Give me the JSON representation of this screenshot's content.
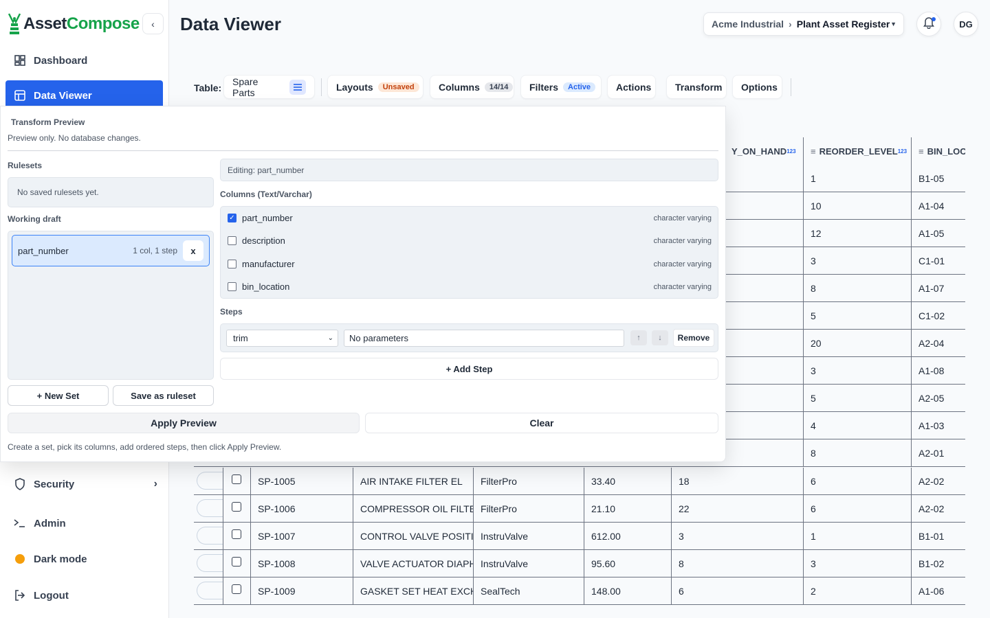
{
  "brand": {
    "name_part1": "Asset",
    "name_part2": "Compose",
    "accent": "#16a34a"
  },
  "sidebar": {
    "items": [
      {
        "label": "Dashboard",
        "icon": "dashboard-icon"
      },
      {
        "label": "Data Viewer",
        "icon": "table-icon",
        "active": true
      },
      {
        "label": "Security",
        "icon": "shield-icon"
      },
      {
        "label": "Admin",
        "icon": "terminal-icon"
      },
      {
        "label": "Dark mode",
        "icon": "theme-dot-icon"
      },
      {
        "label": "Logout",
        "icon": "logout-icon"
      }
    ]
  },
  "header": {
    "title": "Data Viewer",
    "breadcrumb": {
      "org": "Acme Industrial",
      "separator": "›",
      "register": "Plant Asset Register"
    },
    "avatar": "DG"
  },
  "toolbar": {
    "table_label": "Table:",
    "table_value": "Spare Parts",
    "layouts": {
      "label": "Layouts",
      "badge": "Unsaved"
    },
    "columns": {
      "label": "Columns",
      "badge": "14/14"
    },
    "filters": {
      "label": "Filters",
      "badge": "Active"
    },
    "actions": "Actions",
    "transform": "Transform",
    "options": "Options"
  },
  "grid": {
    "headers": [
      "Y_ON_HAND",
      "REORDER_LEVEL",
      "BIN_LOCA"
    ],
    "num_tag": "123",
    "rows_partial": [
      {
        "reorder": "1",
        "bin": "B1-05"
      },
      {
        "reorder": "10",
        "bin": "A1-04"
      },
      {
        "reorder": "12",
        "bin": "A1-05"
      },
      {
        "reorder": "3",
        "bin": "C1-01"
      },
      {
        "reorder": "8",
        "bin": "A1-07"
      },
      {
        "reorder": "5",
        "bin": "C1-02"
      },
      {
        "reorder": "20",
        "bin": "A2-04"
      },
      {
        "reorder": "3",
        "bin": "A1-08"
      },
      {
        "reorder": "5",
        "bin": "A2-05"
      },
      {
        "reorder": "4",
        "bin": "A1-03"
      },
      {
        "reorder": "8",
        "bin": "A2-01"
      }
    ],
    "rows_full": [
      {
        "part": "SP-1005",
        "desc": "AIR INTAKE FILTER EL",
        "mfr": "FilterPro",
        "cost": "33.40",
        "qty": "18",
        "reorder": "6",
        "bin": "A2-02"
      },
      {
        "part": "SP-1006",
        "desc": "COMPRESSOR OIL FILTE",
        "mfr": "FilterPro",
        "cost": "21.10",
        "qty": "22",
        "reorder": "6",
        "bin": "A2-02"
      },
      {
        "part": "SP-1007",
        "desc": "CONTROL VALVE POSITI",
        "mfr": "InstruValve",
        "cost": "612.00",
        "qty": "3",
        "reorder": "1",
        "bin": "B1-01"
      },
      {
        "part": "SP-1008",
        "desc": "VALVE ACTUATOR DIAPH",
        "mfr": "InstruValve",
        "cost": "95.60",
        "qty": "8",
        "reorder": "3",
        "bin": "B1-02"
      },
      {
        "part": "SP-1009",
        "desc": "GASKET SET HEAT EXCH",
        "mfr": "SealTech",
        "cost": "148.00",
        "qty": "6",
        "reorder": "2",
        "bin": "A1-06"
      }
    ]
  },
  "transform": {
    "title": "Transform Preview",
    "subtitle": "Preview only. No database changes.",
    "rulesets_label": "Rulesets",
    "rulesets_empty": "No saved rulesets yet.",
    "draft_label": "Working draft",
    "draft_item": {
      "name": "part_number",
      "meta": "1 col, 1 step",
      "remove": "x"
    },
    "new_set": "+ New Set",
    "save_ruleset": "Save as ruleset",
    "editing": "Editing: part_number",
    "columns_label": "Columns (Text/Varchar)",
    "columns": [
      {
        "name": "part_number",
        "type": "character varying",
        "checked": true
      },
      {
        "name": "description",
        "type": "character varying",
        "checked": false
      },
      {
        "name": "manufacturer",
        "type": "character varying",
        "checked": false
      },
      {
        "name": "bin_location",
        "type": "character varying",
        "checked": false
      }
    ],
    "steps_label": "Steps",
    "step": {
      "op": "trim",
      "params": "No parameters",
      "remove": "Remove"
    },
    "add_step": "+ Add Step",
    "apply": "Apply Preview",
    "clear": "Clear",
    "hint": "Create a set, pick its columns, add ordered steps, then click Apply Preview."
  }
}
